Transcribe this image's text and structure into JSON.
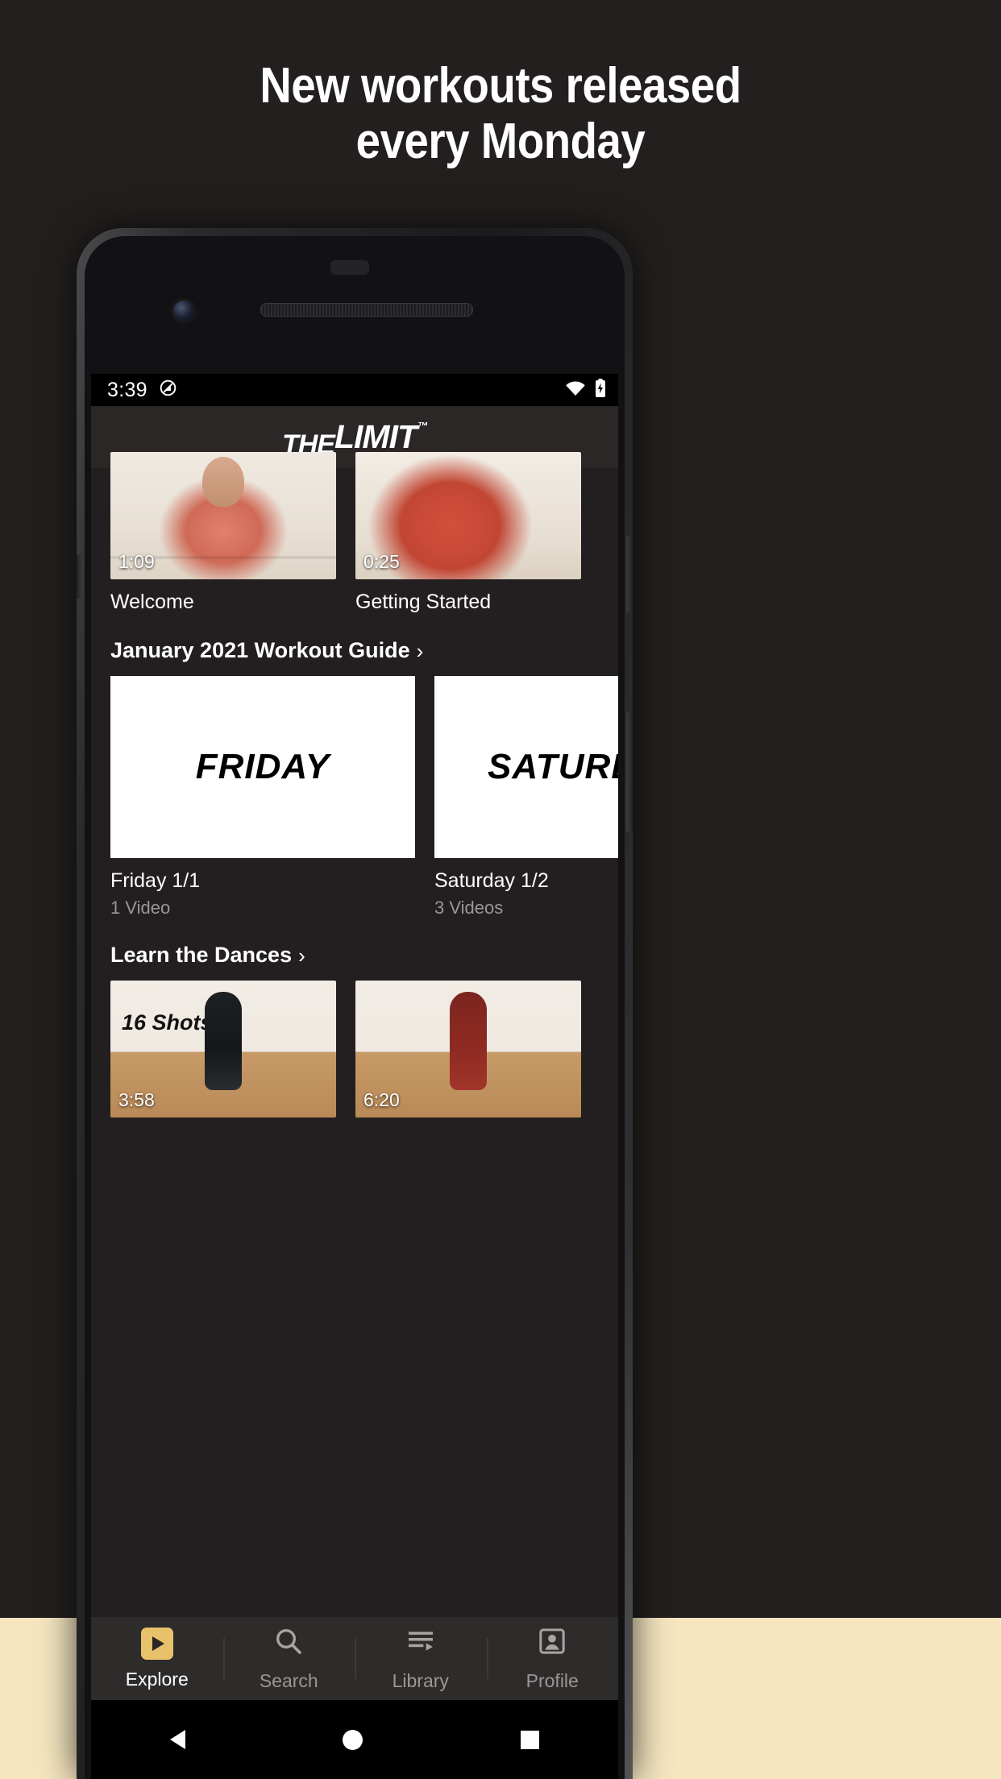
{
  "promo": {
    "line1": "New workouts released",
    "line2": "every Monday"
  },
  "status_bar": {
    "time": "3:39",
    "dnd_icon": "do-not-disturb-icon",
    "wifi_icon": "wifi-icon",
    "battery_icon": "battery-charging-icon"
  },
  "app_bar": {
    "logo_the": "THE",
    "logo_limit": "LIMIT",
    "logo_tm": "™"
  },
  "intro_videos": [
    {
      "title": "Welcome",
      "duration": "1:09"
    },
    {
      "title": "Getting Started",
      "duration": "0:25"
    }
  ],
  "sections": [
    {
      "title": "January 2021 Workout Guide",
      "chevron": "›",
      "cards": [
        {
          "day": "FRIDAY",
          "title": "Friday 1/1",
          "subtitle": "1 Video"
        },
        {
          "day": "SATURDAY",
          "title": "Saturday 1/2",
          "subtitle": "3 Videos"
        }
      ]
    },
    {
      "title": "Learn the Dances",
      "chevron": "›",
      "videos": [
        {
          "overlay_title": "16 Shots",
          "duration": "3:58"
        },
        {
          "overlay_title": "",
          "duration": "6:20"
        }
      ]
    }
  ],
  "tab_bar": {
    "tabs": [
      {
        "label": "Explore",
        "icon": "play-badge-icon",
        "active": true
      },
      {
        "label": "Search",
        "icon": "search-icon",
        "active": false
      },
      {
        "label": "Library",
        "icon": "library-icon",
        "active": false
      },
      {
        "label": "Profile",
        "icon": "person-icon",
        "active": false
      }
    ]
  },
  "nav_bar": {
    "back": "back-triangle-icon",
    "home": "home-circle-icon",
    "recents": "recents-square-icon"
  },
  "colors": {
    "page_background": "#231f1f",
    "cream_band": "#f6e6c0",
    "accent_gold": "#e8c26a",
    "app_background": "#231f20",
    "app_bar": "#2b2727",
    "tab_bar": "#2e2b2b"
  }
}
